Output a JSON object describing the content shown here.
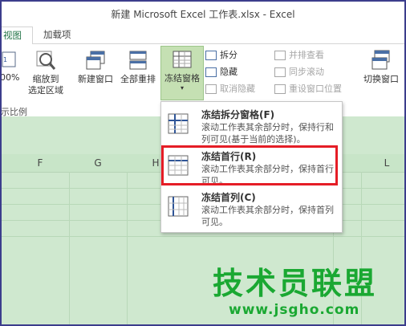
{
  "window": {
    "title": "新建 Microsoft Excel 工作表.xlsx - Excel"
  },
  "tabs": [
    {
      "label": "视图"
    },
    {
      "label": "加载项"
    }
  ],
  "ribbon": {
    "zoom_partial": "00%",
    "zoom_to_selection": [
      "缩放到",
      "选定区域"
    ],
    "new_window": "新建窗口",
    "arrange_all": "全部重排",
    "freeze_panes": "冻结窗格",
    "split": "拆分",
    "hide": "隐藏",
    "unhide": "取消隐藏",
    "view_side_by_side": "并排查看",
    "sync_scroll": "同步滚动",
    "reset_window_position": "重设窗口位置",
    "switch_windows": "切换窗口",
    "group_zoom_label": "示比例"
  },
  "columns": [
    "F",
    "G",
    "H",
    "L"
  ],
  "freeze_menu": {
    "items": [
      {
        "title": "冻结拆分窗格(F)",
        "desc": "滚动工作表其余部分时，保持行和列可见(基于当前的选择)。"
      },
      {
        "title": "冻结首行(R)",
        "desc": "滚动工作表其余部分时，保持首行可见。"
      },
      {
        "title": "冻结首列(C)",
        "desc": "滚动工作表其余部分时，保持首列可见。"
      }
    ]
  },
  "watermark": {
    "name": "技术员联盟",
    "url": "www.jsgho.com"
  },
  "colors": {
    "accent": "#217346",
    "highlight": "#e51d26",
    "sheet": "#cfe8cf",
    "watermark": "#1aa832"
  }
}
